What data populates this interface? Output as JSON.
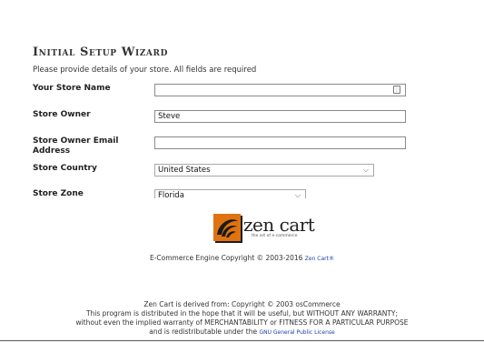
{
  "wizard": {
    "title": "Initial Setup Wizard",
    "subtitle": "Please provide details of your store. All fields are required",
    "fields": [
      {
        "label": "Your Store Name",
        "value": ""
      },
      {
        "label": "Store Owner",
        "value": "Steve"
      },
      {
        "label": "Store Owner Email Address",
        "value": ""
      },
      {
        "label": "Store Country",
        "value": "United States"
      },
      {
        "label": "Store Zone",
        "value": "Florida"
      }
    ]
  },
  "footer": {
    "logo_text": "zen cart",
    "logo_tagline": "the art of e-commerce",
    "copyright_text": "E-Commerce Engine Copyright © 2003-2016",
    "copyright_link": "Zen Cart®",
    "derived_line1": "Zen Cart is derived from: Copyright © 2003 osCommerce",
    "derived_line2": "This program is distributed in the hope that it will be useful, but WITHOUT ANY WARRANTY;",
    "derived_line3": "without even the implied warranty of MERCHANTABILITY or FITNESS FOR A PARTICULAR PURPOSE",
    "derived_line4": "and is redistributable under the",
    "license_link": "GNU General Public License"
  },
  "colors": {
    "link": "#1a3fa8",
    "logo_orange": "#f08a1c"
  }
}
